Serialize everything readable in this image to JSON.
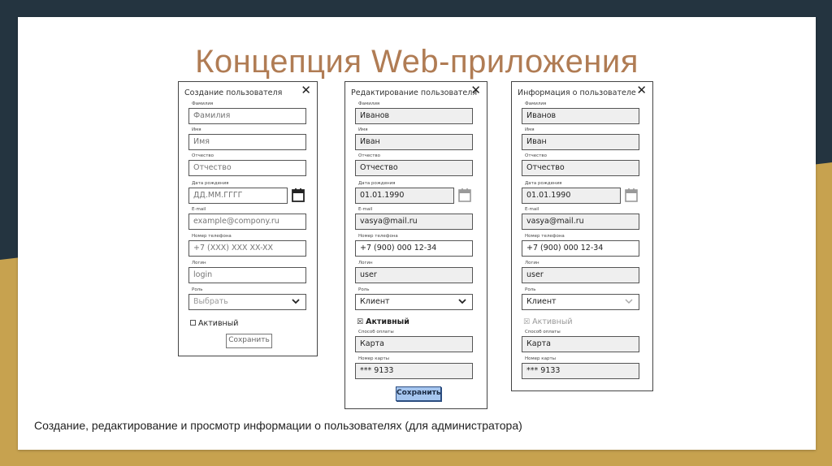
{
  "slide": {
    "title": "Концепция Web-приложения",
    "caption": "Создание, редактирование и просмотр информации о пользователях (для администратора)"
  },
  "colors": {
    "title": "#b07c54",
    "frame": "#243440",
    "gold": "#c7a24f",
    "primary_button": "#a6c6ef"
  },
  "icons": {
    "close": "close-icon",
    "calendar": "calendar-icon",
    "chevron": "chevron-down-icon",
    "checkbox": "checkbox-icon"
  },
  "create_form": {
    "title": "Создание пользователя",
    "close": "✕",
    "fields": [
      {
        "label": "Фамилия",
        "placeholder": "Фамилия"
      },
      {
        "label": "Имя",
        "placeholder": "Имя"
      },
      {
        "label": "Отчество",
        "placeholder": "Отчество"
      },
      {
        "label": "Дата рождения",
        "placeholder": "ДД.ММ.ГГГГ"
      },
      {
        "label": "E-mail",
        "placeholder": "example@compony.ru"
      },
      {
        "label": "Номер телефона",
        "placeholder": "+7 (XXX) XXX XX-XX"
      },
      {
        "label": "Логин",
        "placeholder": "login"
      },
      {
        "label": "Роль",
        "placeholder": "Выбрать"
      }
    ],
    "active_label": "Активный",
    "save_label": "Сохранить"
  },
  "edit_form": {
    "title": "Редактирование пользователя",
    "close": "✕",
    "fields": [
      {
        "label": "Фамилия",
        "value": "Иванов"
      },
      {
        "label": "Имя",
        "value": "Иван"
      },
      {
        "label": "Отчество",
        "value": "Отчество"
      },
      {
        "label": "Дата рождения",
        "value": "01.01.1990"
      },
      {
        "label": "E-mail",
        "value": "vasya@mail.ru"
      },
      {
        "label": "Номер телефона",
        "value": "+7 (900) 000 12-34"
      },
      {
        "label": "Логин",
        "value": "user"
      },
      {
        "label": "Роль",
        "value": "Клиент"
      },
      {
        "label": "Способ оплаты",
        "value": "Карта"
      },
      {
        "label": "Номер карты",
        "value": "*** 9133"
      }
    ],
    "active_label": "Активный",
    "active_mark": "☒",
    "save_label": "Сохранить"
  },
  "info_form": {
    "title": "Информация о пользователе",
    "close": "✕",
    "fields": [
      {
        "label": "Фамилия",
        "value": "Иванов"
      },
      {
        "label": "Имя",
        "value": "Иван"
      },
      {
        "label": "Отчество",
        "value": "Отчество"
      },
      {
        "label": "Дата рождения",
        "value": "01.01.1990"
      },
      {
        "label": "E-mail",
        "value": "vasya@mail.ru"
      },
      {
        "label": "Номер телефона",
        "value": "+7 (900) 000 12-34"
      },
      {
        "label": "Логин",
        "value": "user"
      },
      {
        "label": "Роль",
        "value": "Клиент"
      },
      {
        "label": "Способ оплаты",
        "value": "Карта"
      },
      {
        "label": "Номер карты",
        "value": "*** 9133"
      }
    ],
    "active_label": "Активный",
    "active_mark": "☒"
  }
}
